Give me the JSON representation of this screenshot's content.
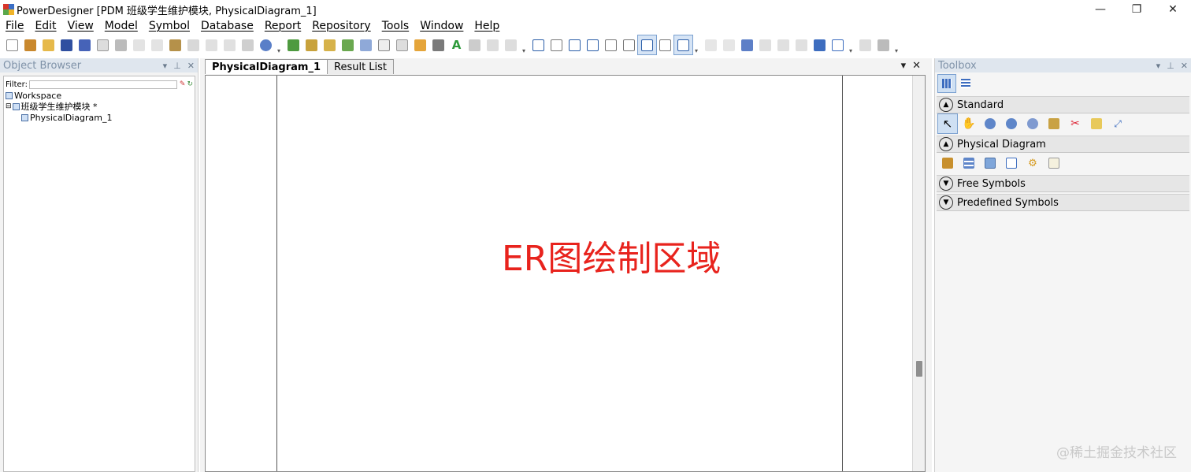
{
  "window": {
    "title": "PowerDesigner [PDM 班级学生维护模块, PhysicalDiagram_1]",
    "minimize": "—",
    "restore": "❐",
    "close": "✕"
  },
  "menu": [
    "File",
    "Edit",
    "View",
    "Model",
    "Symbol",
    "Database",
    "Report",
    "Repository",
    "Tools",
    "Window",
    "Help"
  ],
  "object_browser": {
    "title": "Object Browser",
    "filter_label": "Filter:",
    "tree": [
      {
        "label": "Workspace",
        "level": 0
      },
      {
        "label": "班级学生维护模块 *",
        "level": 0
      },
      {
        "label": "PhysicalDiagram_1",
        "level": 1
      }
    ]
  },
  "document": {
    "tabs": [
      {
        "label": "PhysicalDiagram_1",
        "active": true
      },
      {
        "label": "Result List",
        "active": false
      }
    ],
    "canvas_label": "ER图绘制区域"
  },
  "toolbox": {
    "title": "Toolbox",
    "sections": [
      {
        "label": "Standard",
        "expanded": true
      },
      {
        "label": "Physical Diagram",
        "expanded": true
      },
      {
        "label": "Free Symbols",
        "expanded": false
      },
      {
        "label": "Predefined Symbols",
        "expanded": false
      }
    ]
  },
  "watermark": "@稀土掘金技术社区",
  "colors": {
    "canvas_label": "#e8231d",
    "panel_header_text": "#7f92a8",
    "selection": "#cfe0f3"
  }
}
